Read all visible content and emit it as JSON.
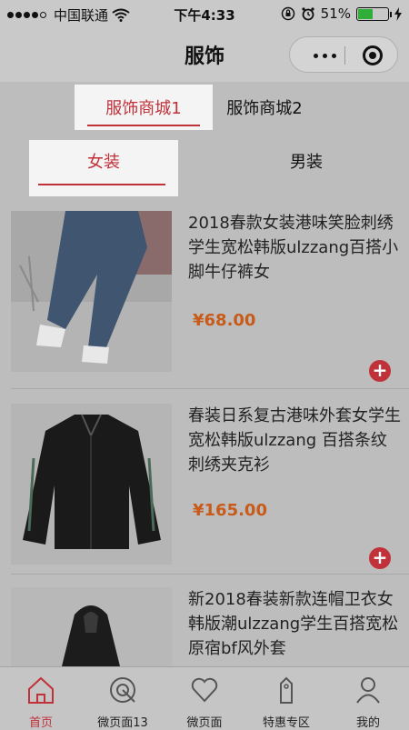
{
  "status_bar": {
    "carrier": "中国联通",
    "time": "下午4:33",
    "battery_percent": "51%",
    "battery_level": 0.51
  },
  "nav": {
    "title": "服饰"
  },
  "tabs_primary": [
    {
      "label": "服饰商城1",
      "active": true
    },
    {
      "label": "服饰商城2",
      "active": false
    }
  ],
  "tabs_secondary": [
    {
      "label": "女装",
      "active": true
    },
    {
      "label": "男装",
      "active": false
    }
  ],
  "products": [
    {
      "name": "2018春款女装港味笑脸刺绣学生宽松韩版ulzzang百搭小脚牛仔裤女",
      "price": "¥68.00",
      "add_label": "+"
    },
    {
      "name": "春装日系复古港味外套女学生宽松韩版ulzzang 百搭条纹刺绣夹克衫",
      "price": "¥165.00",
      "add_label": "+"
    },
    {
      "name": "新2018春装新款连帽卫衣女韩版潮ulzzang学生百搭宽松原宿bf风外套",
      "price": "",
      "add_label": "+"
    }
  ],
  "tab_bar": [
    {
      "label": "首页",
      "icon": "home-icon",
      "active": true
    },
    {
      "label": "微页面13",
      "icon": "target-icon",
      "active": false
    },
    {
      "label": "微页面",
      "icon": "heart-icon",
      "active": false
    },
    {
      "label": "特惠专区",
      "icon": "tag-icon",
      "active": false
    },
    {
      "label": "我的",
      "icon": "user-icon",
      "active": false
    }
  ],
  "colors": {
    "accent": "#c0313a",
    "price": "#c85a1a",
    "battery": "#2faf3a"
  }
}
